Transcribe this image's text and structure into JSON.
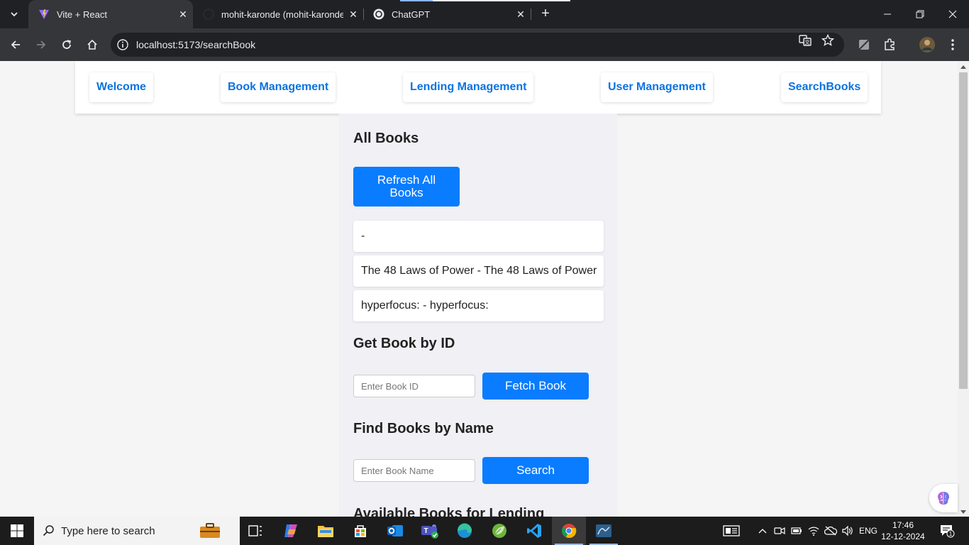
{
  "browser": {
    "tabs": [
      {
        "title": "Vite + React",
        "active": true
      },
      {
        "title": "mohit-karonde (mohit-karonde)",
        "active": false
      },
      {
        "title": "ChatGPT",
        "active": false
      }
    ],
    "url": "localhost:5173/searchBook"
  },
  "nav": {
    "welcome": "Welcome",
    "book_management": "Book Management",
    "lending_management": "Lending Management",
    "user_management": "User Management",
    "search_books": "SearchBooks"
  },
  "all_books": {
    "heading": "All Books",
    "refresh_button": "Refresh All Books",
    "items": [
      "-",
      "The 48 Laws of Power - The 48 Laws of Power",
      "hyperfocus: - hyperfocus:"
    ]
  },
  "get_by_id": {
    "heading": "Get Book by ID",
    "placeholder": "Enter Book ID",
    "button": "Fetch Book"
  },
  "find_by_name": {
    "heading": "Find Books by Name",
    "placeholder": "Enter Book Name",
    "button": "Search"
  },
  "available": {
    "heading": "Available Books for Lending"
  },
  "taskbar": {
    "search_placeholder": "Type here to search",
    "language": "ENG",
    "time": "17:46",
    "date": "12-12-2024",
    "notification_count": "1"
  },
  "colors": {
    "accent": "#0a7cff",
    "nav_link": "#0a73e0"
  }
}
